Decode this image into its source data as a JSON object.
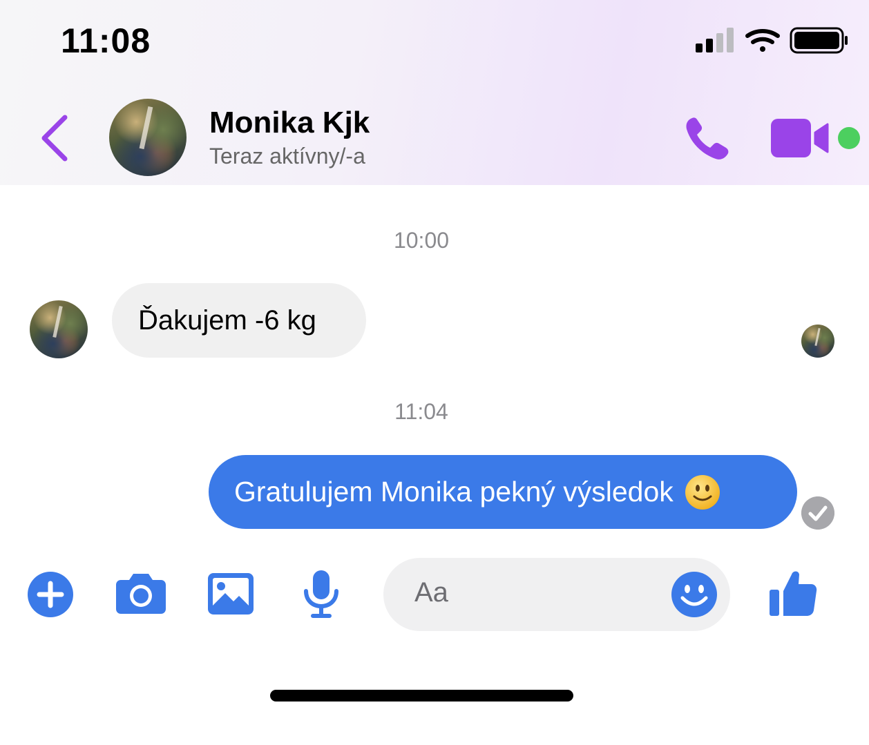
{
  "status_bar": {
    "time": "11:08"
  },
  "header": {
    "contact_name": "Monika Kjk",
    "contact_status": "Teraz aktívny/-a",
    "accent_color": "#9a44e8"
  },
  "messages": [
    {
      "type": "timestamp",
      "text": "10:00"
    },
    {
      "type": "incoming",
      "text": "Ďakujem -6 kg"
    },
    {
      "type": "timestamp",
      "text": "11:04"
    },
    {
      "type": "outgoing",
      "text": "Gratulujem Monika pekný výsledok"
    }
  ],
  "composer": {
    "placeholder": "Aa",
    "accent_color": "#3b7ae8"
  },
  "icons": [
    "back-chevron-icon",
    "phone-icon",
    "video-camera-icon",
    "plus-icon",
    "camera-icon",
    "image-icon",
    "microphone-icon",
    "emoji-icon",
    "thumbs-up-icon",
    "checkmark-icon",
    "smiley-emoji"
  ]
}
